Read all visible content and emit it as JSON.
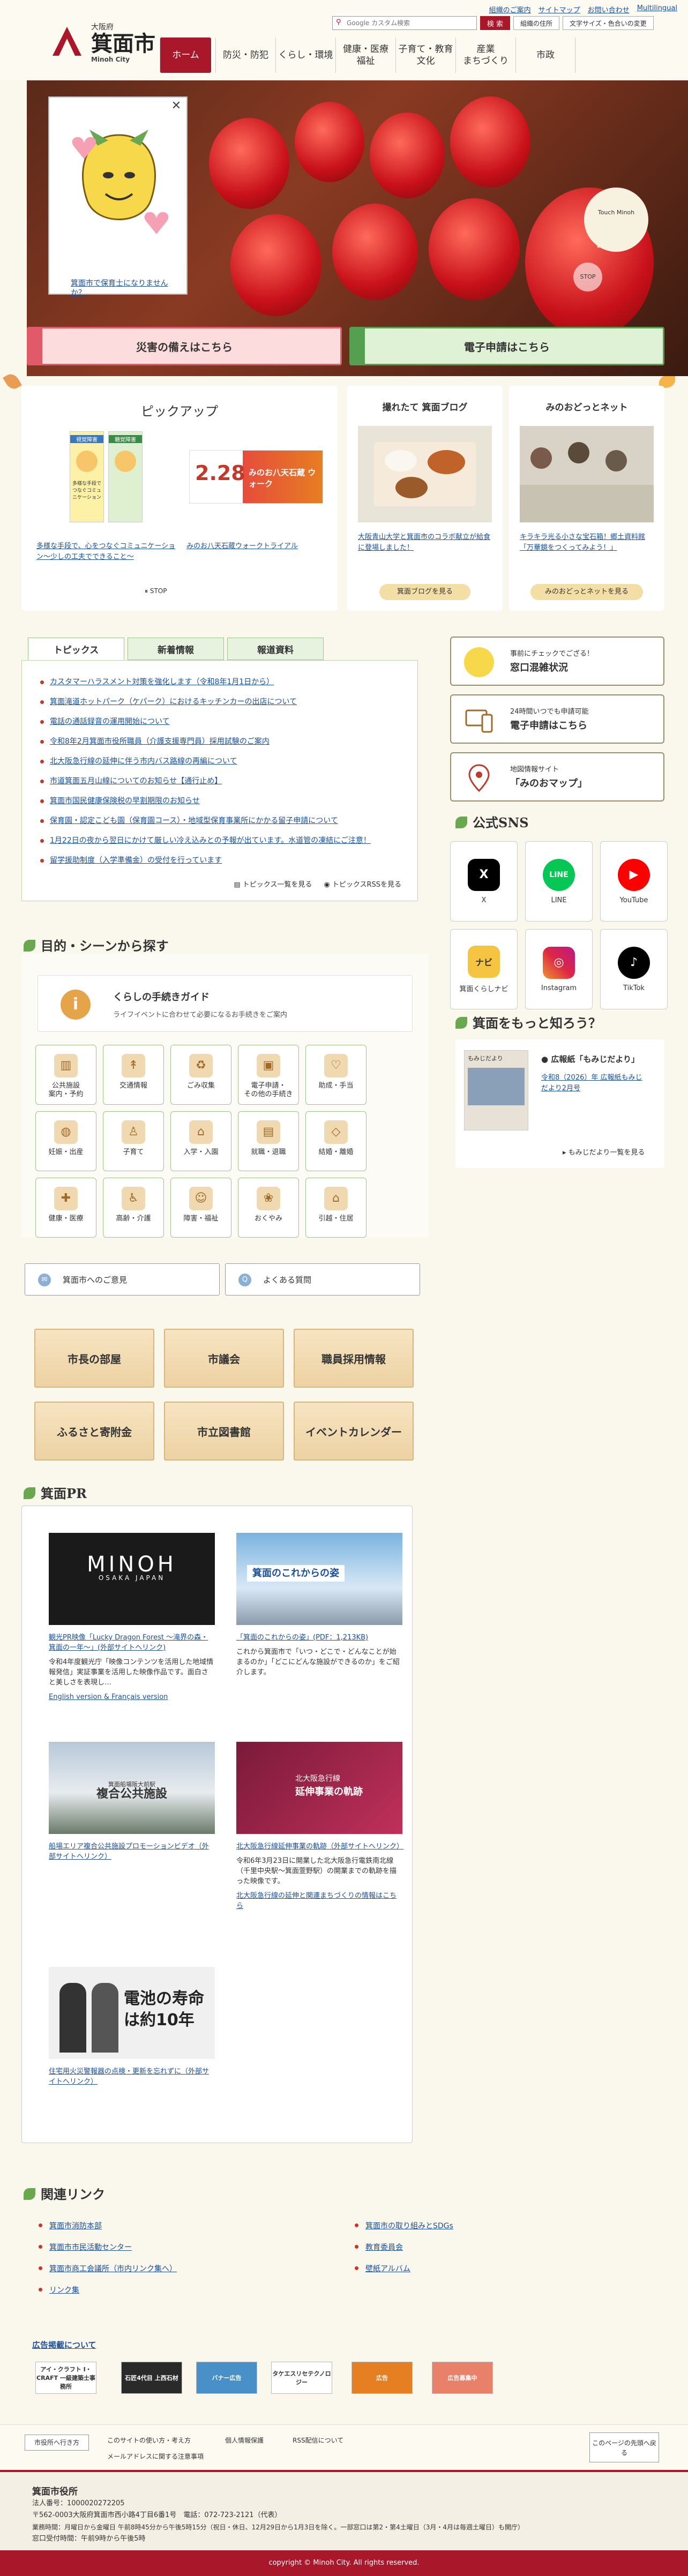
{
  "header": {
    "pref": "大阪府",
    "city": "箕面市",
    "city_en": "Minoh City",
    "toplinks": [
      "組織のご案内",
      "サイトマップ",
      "お問い合わせ",
      "Multilingual"
    ],
    "search_placeholder": "Google カスタム検索",
    "search_button": "検 索",
    "btn_detail": "組織の住所",
    "btn_access": "文字サイズ・色合いの変更",
    "nav": [
      "ホーム",
      "防災・防犯",
      "くらし・環境",
      "健康・医療\n福祉",
      "子育て・教育\n文化",
      "産業\nまちづくり",
      "市政"
    ]
  },
  "hero": {
    "popup_link": "箕面市で保育士になりませんか？",
    "badge": "Touch Minoh",
    "stop": "STOP",
    "dots": "⬤ ● ● ●",
    "btn_disaster": "災害の備えはこちら",
    "btn_apply": "電子申請はこちら",
    "sign": "勝"
  },
  "pickup": {
    "title": "ピックアップ",
    "items": [
      {
        "text": "多様な手段で、心をつなぐコミュニケーション～少しの工夫でできること～"
      },
      {
        "text": "みのお八天石蔵ウォークトライアル",
        "date": "2.28",
        "img_caption": "みのお八天石蔵 ウォーク"
      }
    ],
    "stop": "STOP",
    "img1_top": "視覚障害",
    "img1_right": "聴覚障害",
    "img1_bottom": "多様な手段でつなぐコミュニケーション"
  },
  "blog": {
    "title": "撮れたて 箕面ブログ",
    "text": "大阪青山大学と箕面市のコラボ献立が給食に登場しました！",
    "button": "箕面ブログを見る"
  },
  "net": {
    "title": "みのおどっとネット",
    "text": "キラキラ光る小さな宝石箱！郷土資料館「万華鏡をつくってみよう！」",
    "button": "みのおどっとネットを見る"
  },
  "tabs": [
    "トピックス",
    "新着情報",
    "報道資料"
  ],
  "topics": [
    "カスタマーハラスメント対策を強化します（令和8年1月1日から）",
    "箕面滝道ホットパーク（ケパーク）におけるキッチンカーの出店について",
    "電話の通話録音の運用開始について",
    "令和8年2月箕面市役所職員（介護支援専門員）採用試験のご案内",
    "北大阪急行線の延伸に伴う市内バス路線の再編について",
    "市道箕面五月山線についてのお知らせ【通行止め】",
    "箕面市国民健康保険税の早割期限のお知らせ",
    "保育園・認定こども園（保育園コース）・地域型保育事業所にかかる留子申請について",
    "1月22日の夜から翌日にかけて厳しい冷え込みとの予報が出ています。水道管の凍結にご注意！",
    "留学援助制度（入学準備金）の受付を行っています"
  ],
  "topic_list_link": "トピックス一覧を見る",
  "topic_rss_link": "トピックスRSSを見る",
  "side": {
    "card1_small": "事前にチェックでござる！",
    "card1": "窓口混雑状況",
    "card2_small": "24時間いつでも申請可能",
    "card2": "電子申請はこちら",
    "card3_small": "地図情報サイト",
    "card3": "「みのおマップ」"
  },
  "sns": {
    "title": "公式SNS",
    "items": [
      "X",
      "LINE",
      "YouTube",
      "箕面くらしナビ",
      "Instagram",
      "TikTok"
    ],
    "icon_glyphs": [
      "X",
      "LINE",
      "▶",
      "ナビ",
      "◎",
      "♪"
    ],
    "colors": [
      "#000000",
      "#06c755",
      "#ff0000",
      "#f5c542",
      "#dd2a7b",
      "#000000"
    ]
  },
  "know": {
    "title": "箕面をもっと知ろう？",
    "magazine": "広報紙「もみじだより」",
    "issue": "令和8（2026）年 広報紙もみじだより2月号",
    "list_link": "もみじだより一覧を見る",
    "cover": "もみじだより"
  },
  "purpose": {
    "title": "目的・シーンから探す",
    "guide_title": "くらしの手続きガイド",
    "guide_sub": "ライフイベントに合わせて必要になるお手続きをご案内",
    "items": [
      "公共施設\n案内・予約",
      "交通情報",
      "ごみ収集",
      "電子申請・\nその他の手続き",
      "助成・手当",
      "妊娠・出産",
      "子育て",
      "入学・入園",
      "就職・退職",
      "結婚・離婚",
      "健康・医療",
      "高齢・介護",
      "障害・福祉",
      "おくやみ",
      "引越・住居"
    ],
    "glyphs": [
      "▥",
      "↟",
      "♻",
      "▣",
      "♡",
      "◍",
      "♙",
      "⌂",
      "▤",
      "◇",
      "✚",
      "♿",
      "☺",
      "❀",
      "⌂"
    ],
    "guide_glyph": "i"
  },
  "links": {
    "mail": "箕面市へのご意見",
    "faq": "よくある質問",
    "mail_glyph": "✉",
    "faq_glyph": "Q"
  },
  "gold": [
    "市長の部屋",
    "市議会",
    "職員採用情報",
    "ふるさと寄附金",
    "市立図書館",
    "イベントカレンダー"
  ],
  "pr": {
    "title": "箕面PR",
    "items": [
      {
        "link": "観光PR映像「Lucky Dragon Forest ～滝界の森・箕面の一年～」(外部サイトへリンク)",
        "desc": "令和4年度観光庁「映像コンテンツを活用した地域情報発信」実証事業を活用した映像作品です。面白さと美しさを表現し…",
        "link2": "English version & Français version",
        "img": "MINOH",
        "img_sub": "OSAKA JAPAN"
      },
      {
        "link": "「箕面のこれからの姿」(PDF：1,213KB)",
        "desc": "これから箕面市で「いつ・どこで・どんなことが始まるのか」「どこにどんな施設ができるのか」をご紹介します。",
        "img": "箕面のこれからの姿"
      },
      {
        "link": "船場エリア複合公共施設プロモーションビデオ（外部サイトへリンク）",
        "img": "複合公共施設",
        "img_sub": "箕面船場阪大前駅"
      },
      {
        "link": "北大阪急行線延伸事業の軌跡（外部サイトへリンク）",
        "desc": "令和6年3月23日に開業した北大阪急行電鉄南北線（千里中央駅～箕面萱野駅）の開業までの軌跡を描った映像です。",
        "link2": "北大阪急行線の延伸と関連まちづくりの情報はこちら",
        "img": "北大阪急行線",
        "img_sub": "延伸事業の軌跡"
      },
      {
        "link": "住宅用火災警報器の点検・更新を忘れずに（外部サイトへリンク）",
        "img": "電池の寿命は約10年"
      }
    ]
  },
  "related": {
    "title": "関連リンク",
    "left": [
      "箕面市消防本部",
      "箕面市市民活動センター",
      "箕面市商工会議所（市内リンク集へ）",
      "リンク集"
    ],
    "right": [
      "箕面市の取り組みとSDGs",
      "教育委員会",
      "壁紙アルバム"
    ]
  },
  "ads": {
    "title": "広告掲載について",
    "items": [
      "アイ・クラフト I・CRAFT 一級建築士事務所",
      "石匠4代目 上西石材",
      "バナー広告",
      "タケエスリセテクノロジー",
      "広告",
      "広告募集中"
    ]
  },
  "footer": {
    "howto": "市役所へ行き方",
    "links": [
      "このサイトの使い方・考え方",
      "個人情報保護",
      "RSS配信について",
      "メールアドレスに関する注意事項"
    ],
    "pagetop": "このページの先頭へ戻る",
    "org": "箕面市役所",
    "corp": "法人番号：1000020272205",
    "addr": "〒562-0003大阪府箕面市西小路4丁目6番1号　電話：072-723-2121（代表）",
    "hours": "業務時間：月曜日から金曜日 午前8時45分から午後5時15分（祝日・休日、12月29日から1月3日を除く。一部窓口は第2・第4土曜日（3月・4月は毎週土曜日）も開庁）",
    "hours2": "窓口受付時間：午前9時から午後5時",
    "copyright": "copyright © Minoh City. All rights reserved."
  }
}
